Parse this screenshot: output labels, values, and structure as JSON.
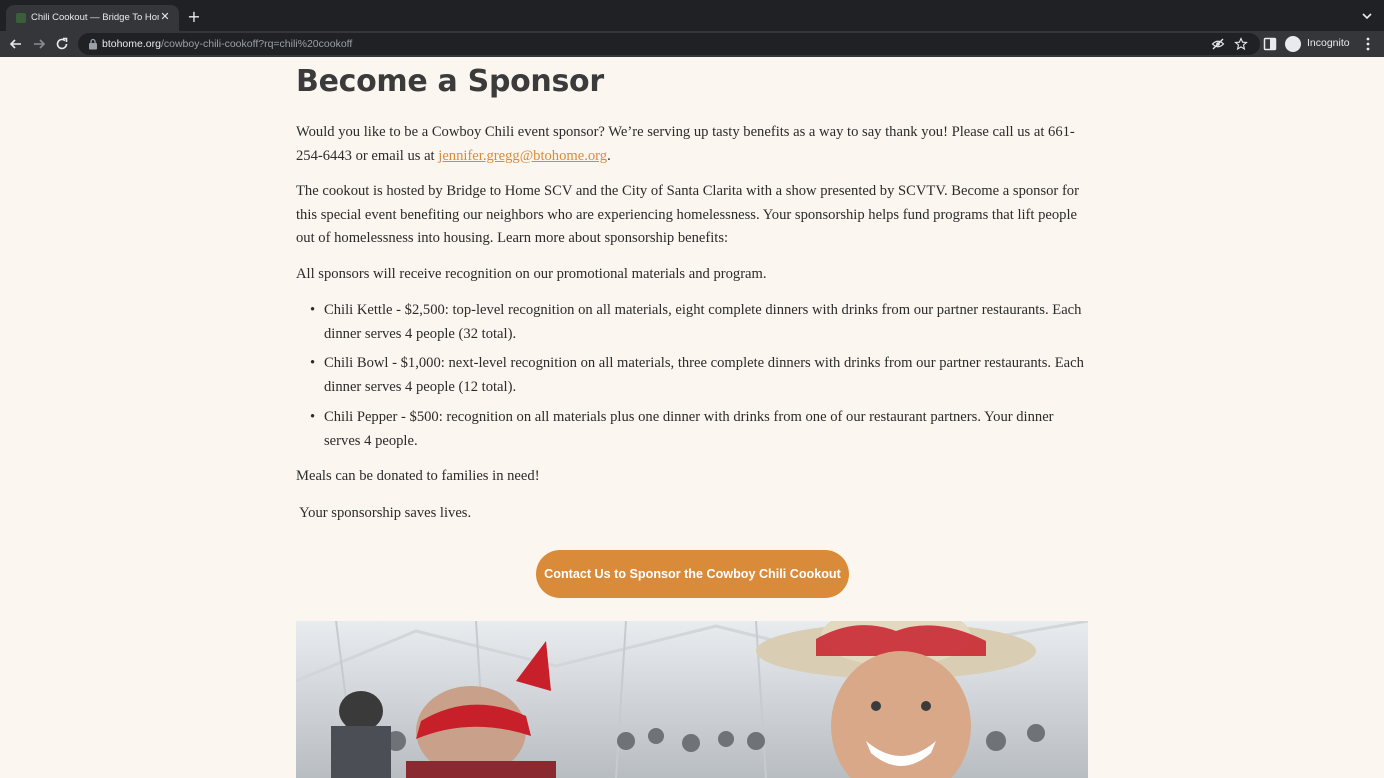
{
  "browser": {
    "tab_title": "Chili Cookout — Bridge To Home",
    "url_host": "btohome.org",
    "url_path": "/cowboy-chili-cookoff?rq=chili%20cookoff",
    "profile_label": "Incognito"
  },
  "page": {
    "heading": "Become a Sponsor",
    "intro_text": "Would you like to be a Cowboy Chili event sponsor? We’re serving up tasty benefits as a way to say thank you! Please call us at 661-254-6443 or email us at ",
    "email_link": "jennifer.gregg@btohome.org",
    "intro_end": ".",
    "paragraph_2": "The cookout is hosted by Bridge to Home SCV and the City of Santa Clarita with a show presented by SCVTV. Become a sponsor for this special event benefiting our neighbors who are experiencing homelessness. Your sponsorship helps fund programs that lift people out of homelessness into housing. Learn more about sponsorship benefits:",
    "paragraph_3": "All sponsors will receive recognition on our promotional materials and program.",
    "tiers": [
      "Chili Kettle - $2,500: top-level recognition on all materials, eight complete dinners with drinks from our partner restaurants. Each dinner serves 4 people (32 total).",
      "Chili Bowl - $1,000: next-level recognition on all materials, three complete dinners with drinks from our partner restaurants. Each dinner serves 4 people (12 total).",
      "Chili Pepper - $500: recognition on all materials plus one dinner with drinks from one of our restaurant partners. Your dinner serves 4 people."
    ],
    "paragraph_4": "Meals can be donated to families in need!",
    "paragraph_5": " Your sponsorship saves lives.",
    "cta_label": "Contact Us to Sponsor the Cowboy Chili Cookout"
  },
  "colors": {
    "accent": "#d98b3a",
    "page_background": "#fbf6ef",
    "chrome_dark": "#202124",
    "chrome_toolbar": "#35363a"
  },
  "icons": [
    "favicon",
    "close-icon",
    "plus-icon",
    "chevron-down-icon",
    "back-arrow-icon",
    "forward-arrow-icon",
    "reload-icon",
    "lock-icon",
    "eye-off-icon",
    "star-icon",
    "side-panel-icon",
    "incognito-icon",
    "kebab-menu-icon"
  ]
}
